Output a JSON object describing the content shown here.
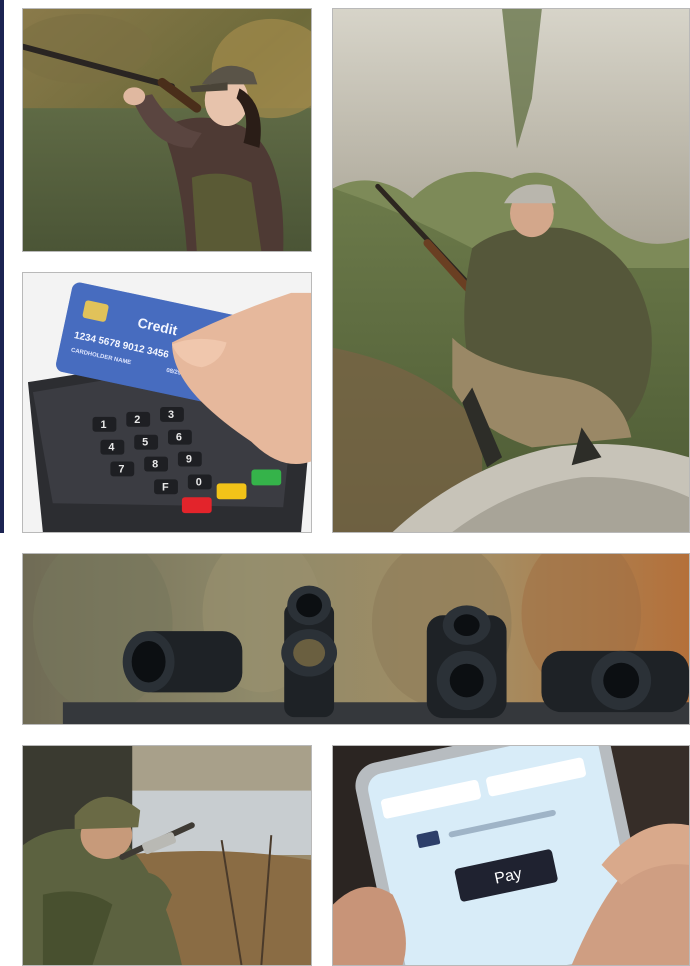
{
  "gallery": {
    "tiles": [
      {
        "subject": "woman hunter aiming shotgun by river"
      },
      {
        "subject": "credit card tapped on payment terminal",
        "card": {
          "brand_text": "Credit",
          "number_text": "1234 5678 9012 3456",
          "holder_text": "CARDHOLDER NAME",
          "expiry_text": "08/25"
        },
        "keypad": [
          "1",
          "2",
          "3",
          "4",
          "5",
          "6",
          "7",
          "8",
          "9",
          "F",
          "0"
        ]
      },
      {
        "subject": "hunter with rifle crouching on cliff"
      },
      {
        "subject": "rifle scopes and red-dot sights on display"
      },
      {
        "subject": "camouflaged hunter aiming rifle in woods"
      },
      {
        "subject": "hand holding smartphone with payment screen",
        "phone": {
          "pay_label": "Pay"
        }
      }
    ]
  },
  "colors": {
    "accent_bar": "#1c2452",
    "tile_border": "#b9b9b9",
    "pay_button": "#1f2230",
    "terminal_red": "#e3242b",
    "terminal_yellow": "#f2c318",
    "terminal_green": "#35b34a"
  }
}
